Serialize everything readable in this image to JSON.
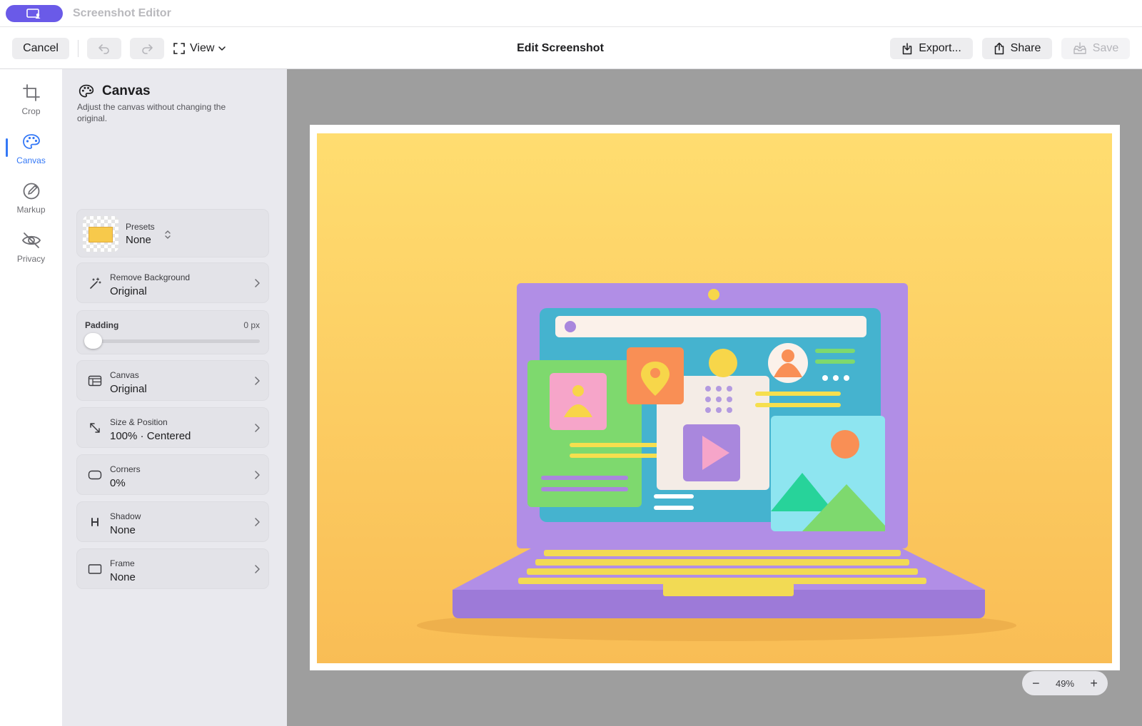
{
  "window": {
    "app_title": "Screenshot Editor",
    "app_icon": "screen-person-icon"
  },
  "toolbar": {
    "cancel_label": "Cancel",
    "view_label": "View",
    "title": "Edit Screenshot",
    "export_label": "Export...",
    "share_label": "Share",
    "save_label": "Save"
  },
  "nav": {
    "active": "Canvas",
    "items": [
      {
        "label": "Crop",
        "icon": "crop-icon"
      },
      {
        "label": "Canvas",
        "icon": "palette-icon"
      },
      {
        "label": "Markup",
        "icon": "markup-icon"
      },
      {
        "label": "Privacy",
        "icon": "eye-slash-icon"
      }
    ]
  },
  "panel": {
    "title": "Canvas",
    "description": "Adjust the canvas without changing the original.",
    "presets": {
      "label": "Presets",
      "value": "None"
    },
    "remove_background": {
      "label": "Remove Background",
      "value": "Original"
    },
    "padding": {
      "label": "Padding",
      "value": "0 px",
      "level": 0
    },
    "canvas": {
      "label": "Canvas",
      "value": "Original"
    },
    "size_position": {
      "label": "Size & Position",
      "value": "100% · Centered"
    },
    "corners": {
      "label": "Corners",
      "value": "0%"
    },
    "shadow": {
      "label": "Shadow",
      "value": "None"
    },
    "frame": {
      "label": "Frame",
      "value": "None"
    }
  },
  "zoom": {
    "value": "49%"
  },
  "colors": {
    "accent": "#3478f6",
    "app_pill": "#6a5ae8",
    "panel_bg": "#e9e9ee",
    "canvas_bg": "#9e9e9e",
    "photo_bg": "#fbc257"
  }
}
